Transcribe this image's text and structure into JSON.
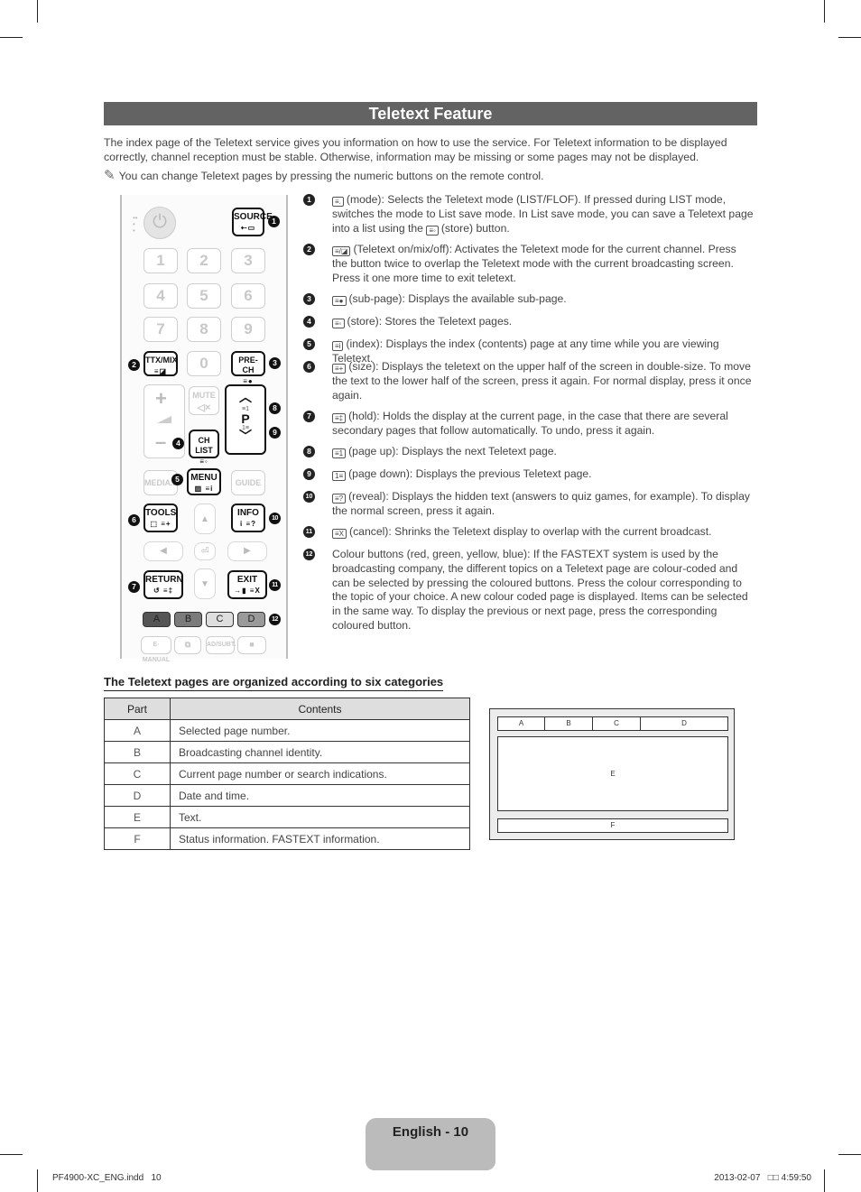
{
  "section_title": "Teletext Feature",
  "intro": "The index page of the Teletext service gives you information on how to use the service. For Teletext information to be displayed correctly, channel reception must be stable. Otherwise, information may be missing or some pages may not be displayed.",
  "note": {
    "icon": "pencil-note-icon",
    "text": "You can change Teletext pages by pressing the numeric buttons on the remote control."
  },
  "remote": {
    "source_label": "SOURCE",
    "numbers": [
      "1",
      "2",
      "3",
      "4",
      "5",
      "6",
      "7",
      "8",
      "9",
      "0"
    ],
    "ttx_label": "TTX/MIX",
    "prech_label": "PRE-CH",
    "mute_label": "MUTE",
    "chlist_label": "CH LIST",
    "p_label": "P",
    "media_label": "MEDIA.P",
    "menu_label": "MENU",
    "guide_label": "GUIDE",
    "tools_label": "TOOLS",
    "info_label": "INFO",
    "return_label": "RETURN",
    "exit_label": "EXIT",
    "color_buttons": [
      {
        "label": "A",
        "color": "#555555"
      },
      {
        "label": "B",
        "color": "#7b7b7b"
      },
      {
        "label": "C",
        "color": "#dedede"
      },
      {
        "label": "D",
        "color": "#9a9a9a"
      }
    ],
    "emanual_label": "E-MANUAL",
    "adsubt_label": "AD/SUBT.",
    "callouts": [
      "1",
      "2",
      "3",
      "4",
      "5",
      "6",
      "7",
      "8",
      "9",
      "10",
      "11",
      "12"
    ]
  },
  "items": [
    {
      "num": "1",
      "icon": "mode-icon",
      "glyph": "≡.",
      "text": "(mode): Selects the Teletext mode (LIST/FLOF). If pressed during LIST mode, switches the mode to List save mode. In List save mode, you can save a Teletext page into a list using the",
      "icon2": "≡◦",
      "text2": "(store) button."
    },
    {
      "num": "2",
      "icon": "teletext-on-mix-off-icon",
      "glyph": "≡/◪",
      "text": "(Teletext on/mix/off): Activates the Teletext mode for the current channel. Press the button twice to overlap the Teletext mode with the current broadcasting screen. Press it one more time to exit teletext."
    },
    {
      "num": "3",
      "icon": "sub-page-icon",
      "glyph": "≡●",
      "text": "(sub-page): Displays the available sub-page."
    },
    {
      "num": "4",
      "icon": "store-icon",
      "glyph": "≡◦",
      "text": "(store): Stores the Teletext pages."
    },
    {
      "num": "5",
      "icon": "index-icon",
      "glyph": "≡i",
      "text": "(index): Displays the index (contents) page at any time while you are viewing Teletext."
    },
    {
      "num": "6",
      "icon": "size-icon",
      "glyph": "≡+",
      "text": "(size): Displays the teletext on the upper half of the screen in double-size. To move the text to the lower half of the screen, press it again. For normal display, press it once again."
    },
    {
      "num": "7",
      "icon": "hold-icon",
      "glyph": "≡‡",
      "text": "(hold): Holds the display at the current page, in the case that there are several secondary pages that follow automatically. To undo, press it again."
    },
    {
      "num": "8",
      "icon": "page-up-icon",
      "glyph": "≡1",
      "text": "(page up): Displays the next Teletext page."
    },
    {
      "num": "9",
      "icon": "page-down-icon",
      "glyph": "1≡",
      "text": "(page down): Displays the previous Teletext page."
    },
    {
      "num": "10",
      "icon": "reveal-icon",
      "glyph": "≡?",
      "text": "(reveal): Displays the hidden text (answers to quiz games, for example). To display the normal screen, press it again."
    },
    {
      "num": "11",
      "icon": "cancel-icon",
      "glyph": "≡X",
      "text": "(cancel): Shrinks the Teletext display to overlap with the current broadcast."
    },
    {
      "num": "12",
      "icon": "",
      "glyph": "",
      "text": "Colour buttons (red, green, yellow, blue): If the FASTEXT system is used by the broadcasting company, the different topics on a Teletext page are colour-coded and can be selected by pressing the coloured buttons. Press the colour corresponding to the topic of your choice. A new colour coded page is displayed. Items can be selected in the same way. To display the previous or next page, press the corresponding coloured button."
    }
  ],
  "table": {
    "title": "The Teletext pages are organized according to six categories",
    "headers": [
      "Part",
      "Contents"
    ],
    "rows": [
      [
        "A",
        "Selected page number."
      ],
      [
        "B",
        "Broadcasting channel identity."
      ],
      [
        "C",
        "Current page number or search indications."
      ],
      [
        "D",
        "Date and time."
      ],
      [
        "E",
        "Text."
      ],
      [
        "F",
        "Status information. FASTEXT information."
      ]
    ]
  },
  "diagram": {
    "header_parts": [
      "A",
      "B",
      "C",
      "D"
    ],
    "body_part": "E",
    "footer_part": "F"
  },
  "page_label": "English - 10",
  "footer": {
    "left": "PF4900-XC_ENG.indd   10",
    "right": "2013-02-07   □□ 4:59:50"
  }
}
